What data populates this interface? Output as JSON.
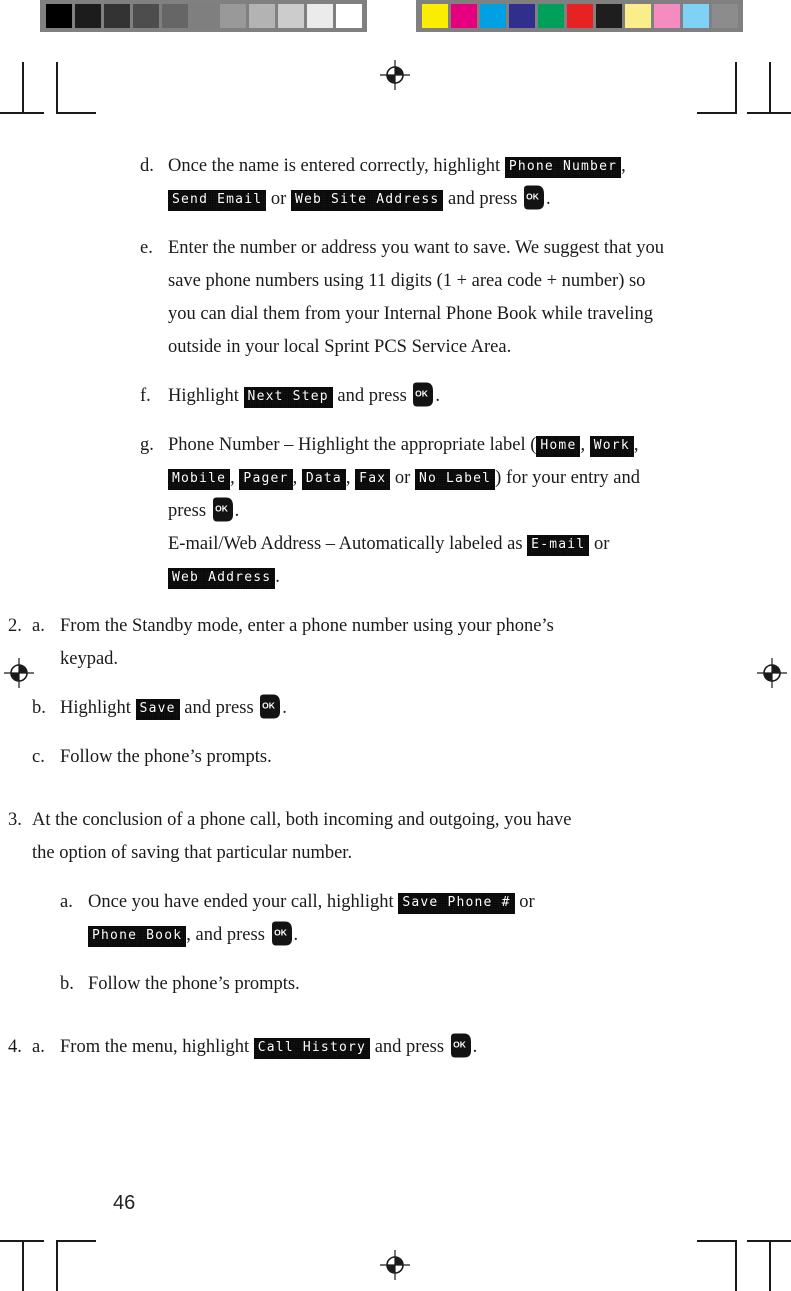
{
  "calibration": {
    "gray_strip_name": "grayscale-calibration-strip",
    "gray_patches": [
      "#000000",
      "#1c1c1c",
      "#333333",
      "#4d4d4d",
      "#666666",
      "#7f7f7f",
      "#999999",
      "#b3b3b3",
      "#cccccc",
      "#ebebeb",
      "#ffffff"
    ],
    "color_strip_name": "color-calibration-strip",
    "color_patches": [
      "#faed00",
      "#e6007e",
      "#00a0e3",
      "#30308c",
      "#00a05a",
      "#e62222",
      "#1e1e1e",
      "#faee8c",
      "#f58cc0",
      "#7fd2f5",
      "#8c8c8c"
    ]
  },
  "icons": {
    "registration": "registration-target-icon",
    "ok_key": "ok-key-icon",
    "ok_key_label": "OK"
  },
  "content": {
    "items": [
      {
        "kind": "sub",
        "indent": "level-1",
        "letter": "d.",
        "runs": [
          {
            "t": "text",
            "v": "Once the name is entered correctly, highlight "
          },
          {
            "t": "lcd",
            "v": "Phone Number"
          },
          {
            "t": "text",
            "v": ", "
          },
          {
            "t": "lcd",
            "v": "Send Email"
          },
          {
            "t": "text",
            "v": " or "
          },
          {
            "t": "lcd",
            "v": "Web Site Address"
          },
          {
            "t": "text",
            "v": " and press "
          },
          {
            "t": "ok"
          },
          {
            "t": "text",
            "v": "."
          }
        ]
      },
      {
        "kind": "sub",
        "indent": "level-1",
        "letter": "e.",
        "runs": [
          {
            "t": "text",
            "v": "Enter the number or address you want to save. We suggest that you save phone numbers using 11 digits (1 + area code + number) so you can dial them from your Internal Phone Book while traveling outside in your local Sprint PCS Service Area."
          }
        ]
      },
      {
        "kind": "sub",
        "indent": "level-1",
        "letter": "f.",
        "runs": [
          {
            "t": "text",
            "v": "Highlight "
          },
          {
            "t": "lcd",
            "v": "Next Step"
          },
          {
            "t": "text",
            "v": " and press "
          },
          {
            "t": "ok"
          },
          {
            "t": "text",
            "v": "."
          }
        ]
      },
      {
        "kind": "sub",
        "indent": "level-1",
        "letter": "g.",
        "runs": [
          {
            "t": "text",
            "v": "Phone Number – Highlight the appropriate label ("
          },
          {
            "t": "lcd",
            "v": "Home"
          },
          {
            "t": "text",
            "v": ", "
          },
          {
            "t": "lcd",
            "v": "Work"
          },
          {
            "t": "text",
            "v": ", "
          },
          {
            "t": "lcd",
            "v": "Mobile"
          },
          {
            "t": "text",
            "v": ", "
          },
          {
            "t": "lcd",
            "v": "Pager"
          },
          {
            "t": "text",
            "v": ", "
          },
          {
            "t": "lcd",
            "v": "Data"
          },
          {
            "t": "text",
            "v": ", "
          },
          {
            "t": "lcd",
            "v": "Fax"
          },
          {
            "t": "text",
            "v": " or "
          },
          {
            "t": "lcd",
            "v": "No Label"
          },
          {
            "t": "text",
            "v": ") for your entry and press "
          },
          {
            "t": "ok"
          },
          {
            "t": "text",
            "v": "."
          },
          {
            "t": "br"
          },
          {
            "t": "text",
            "v": "E-mail/Web Address – Automatically labeled as "
          },
          {
            "t": "lcd",
            "v": "E-mail"
          },
          {
            "t": "text",
            "v": " or "
          },
          {
            "t": "lcd",
            "v": "Web Address"
          },
          {
            "t": "text",
            "v": "."
          }
        ]
      },
      {
        "kind": "step",
        "number": "2.",
        "subs": [
          {
            "letter": "a.",
            "runs": [
              {
                "t": "text",
                "v": "From the Standby mode, enter a phone number using your phone’s keypad."
              }
            ]
          },
          {
            "letter": "b.",
            "runs": [
              {
                "t": "text",
                "v": "Highlight "
              },
              {
                "t": "lcd",
                "v": "Save"
              },
              {
                "t": "text",
                "v": " and press "
              },
              {
                "t": "ok"
              },
              {
                "t": "text",
                "v": "."
              }
            ]
          },
          {
            "letter": "c.",
            "runs": [
              {
                "t": "text",
                "v": "Follow the phone’s prompts."
              }
            ]
          }
        ]
      },
      {
        "kind": "step",
        "number": "3.",
        "lead": [
          {
            "t": "text",
            "v": "At the conclusion of a phone call, both incoming and outgoing, you have the option of saving that particular number."
          }
        ],
        "subs": [
          {
            "letter": "a.",
            "runs": [
              {
                "t": "text",
                "v": "Once you have ended your call, highlight "
              },
              {
                "t": "lcd",
                "v": "Save Phone #"
              },
              {
                "t": "text",
                "v": " or "
              },
              {
                "t": "lcd",
                "v": "Phone Book"
              },
              {
                "t": "text",
                "v": ", and press "
              },
              {
                "t": "ok"
              },
              {
                "t": "text",
                "v": "."
              }
            ]
          },
          {
            "letter": "b.",
            "runs": [
              {
                "t": "text",
                "v": "Follow the phone’s prompts."
              }
            ]
          }
        ]
      },
      {
        "kind": "step",
        "number": "4.",
        "subs": [
          {
            "letter": "a.",
            "runs": [
              {
                "t": "text",
                "v": "From the menu, highlight "
              },
              {
                "t": "lcd",
                "v": "Call History"
              },
              {
                "t": "text",
                "v": " and press "
              },
              {
                "t": "ok"
              },
              {
                "t": "text",
                "v": "."
              }
            ]
          }
        ]
      }
    ]
  },
  "footer": {
    "page_number": "46"
  }
}
